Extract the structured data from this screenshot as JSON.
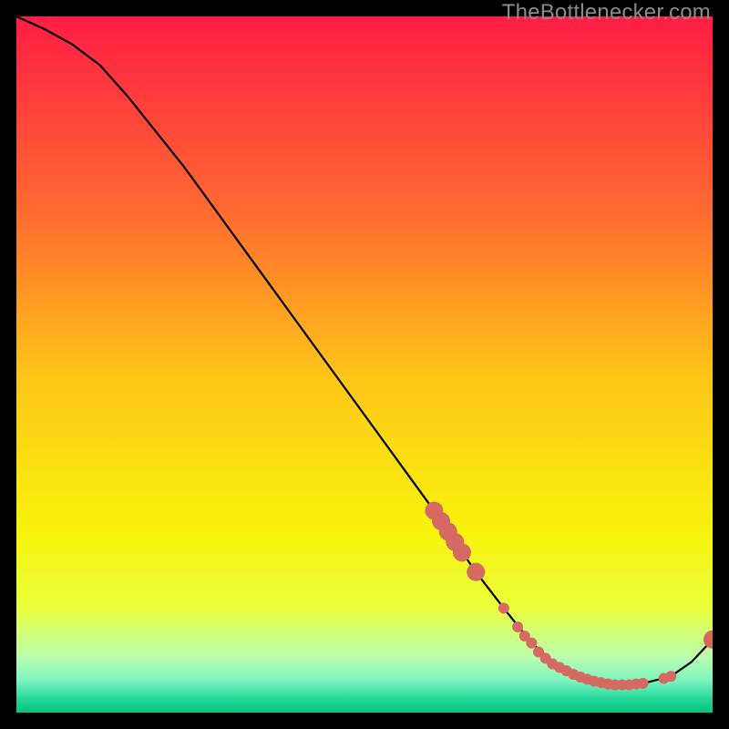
{
  "watermark": "TheBottlenecker.com",
  "chart_data": {
    "type": "line",
    "title": "",
    "xlabel": "",
    "ylabel": "",
    "xlim": [
      0,
      100
    ],
    "ylim": [
      0,
      100
    ],
    "background_gradient": {
      "stops": [
        {
          "pos": 0.0,
          "color": "#ff1d44"
        },
        {
          "pos": 0.28,
          "color": "#ff6a30"
        },
        {
          "pos": 0.52,
          "color": "#ffc619"
        },
        {
          "pos": 0.74,
          "color": "#f8f30b"
        },
        {
          "pos": 0.85,
          "color": "#e9ff3d"
        },
        {
          "pos": 0.92,
          "color": "#baffad"
        },
        {
          "pos": 0.955,
          "color": "#7bf3c0"
        },
        {
          "pos": 0.978,
          "color": "#2bdc9b"
        },
        {
          "pos": 1.0,
          "color": "#07c07f"
        }
      ]
    },
    "curve": {
      "x": [
        0,
        4,
        8,
        12,
        16,
        20,
        24,
        28,
        32,
        36,
        40,
        44,
        48,
        52,
        56,
        60,
        63,
        66,
        70,
        74,
        78,
        82,
        86,
        90,
        94,
        97,
        100
      ],
      "y": [
        100,
        98.2,
        96.0,
        93.0,
        88.5,
        83.5,
        78.5,
        73.0,
        67.5,
        62.0,
        56.5,
        51.0,
        45.5,
        40.0,
        34.5,
        29.0,
        24.5,
        20.2,
        15.0,
        10.0,
        6.5,
        4.5,
        4.0,
        4.2,
        5.2,
        7.3,
        10.5
      ]
    },
    "markers": {
      "x": [
        60,
        61,
        62,
        63,
        64,
        66,
        70,
        72,
        73,
        74,
        75,
        76,
        77,
        78,
        79,
        80,
        81,
        82,
        83,
        84,
        85,
        86,
        87,
        88,
        89,
        90,
        93,
        94,
        100
      ],
      "y": [
        29.0,
        27.5,
        26.0,
        24.5,
        23.0,
        20.2,
        15.0,
        12.3,
        11.0,
        10.0,
        8.7,
        7.8,
        7.0,
        6.5,
        6.0,
        5.5,
        5.1,
        4.8,
        4.5,
        4.3,
        4.1,
        4.0,
        4.0,
        4.0,
        4.1,
        4.2,
        4.9,
        5.2,
        10.5
      ]
    },
    "marker_style": {
      "fill": "#d46a61",
      "radius_small": 6,
      "radius_large": 10
    }
  }
}
